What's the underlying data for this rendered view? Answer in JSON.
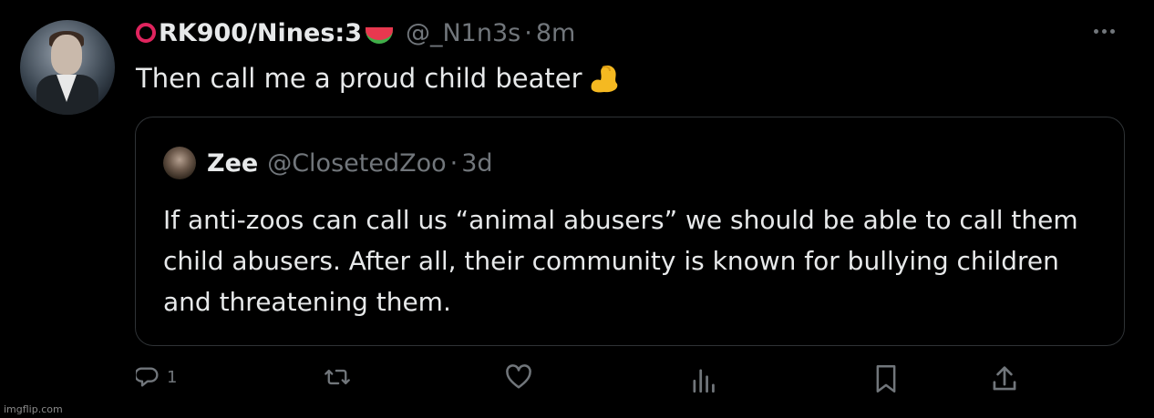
{
  "tweet": {
    "display_name": "RK900/Nines:3",
    "handle": "@_N1n3s",
    "separator": "·",
    "time": "8m",
    "text": "Then call me a proud child beater",
    "name_prefix_emoji": "red-circle-emoji",
    "name_suffix_emoji": "watermelon-emoji",
    "text_suffix_emoji": "flexed-biceps-emoji"
  },
  "quote": {
    "display_name": "Zee",
    "handle": "@ClosetedZoo",
    "separator": "·",
    "time": "3d",
    "text": "If anti-zoos can call us “animal abusers” we should be able to call them child abusers. After all, their community is known for bullying children and threatening them."
  },
  "actions": {
    "reply_count": "1",
    "icons": [
      "reply-icon",
      "retweet-icon",
      "like-icon",
      "views-icon",
      "bookmark-icon",
      "share-icon"
    ]
  },
  "watermark": "imgflip.com",
  "colors": {
    "background": "#000000",
    "text": "#e7e9ea",
    "muted": "#71767b",
    "border": "#2f3336"
  }
}
